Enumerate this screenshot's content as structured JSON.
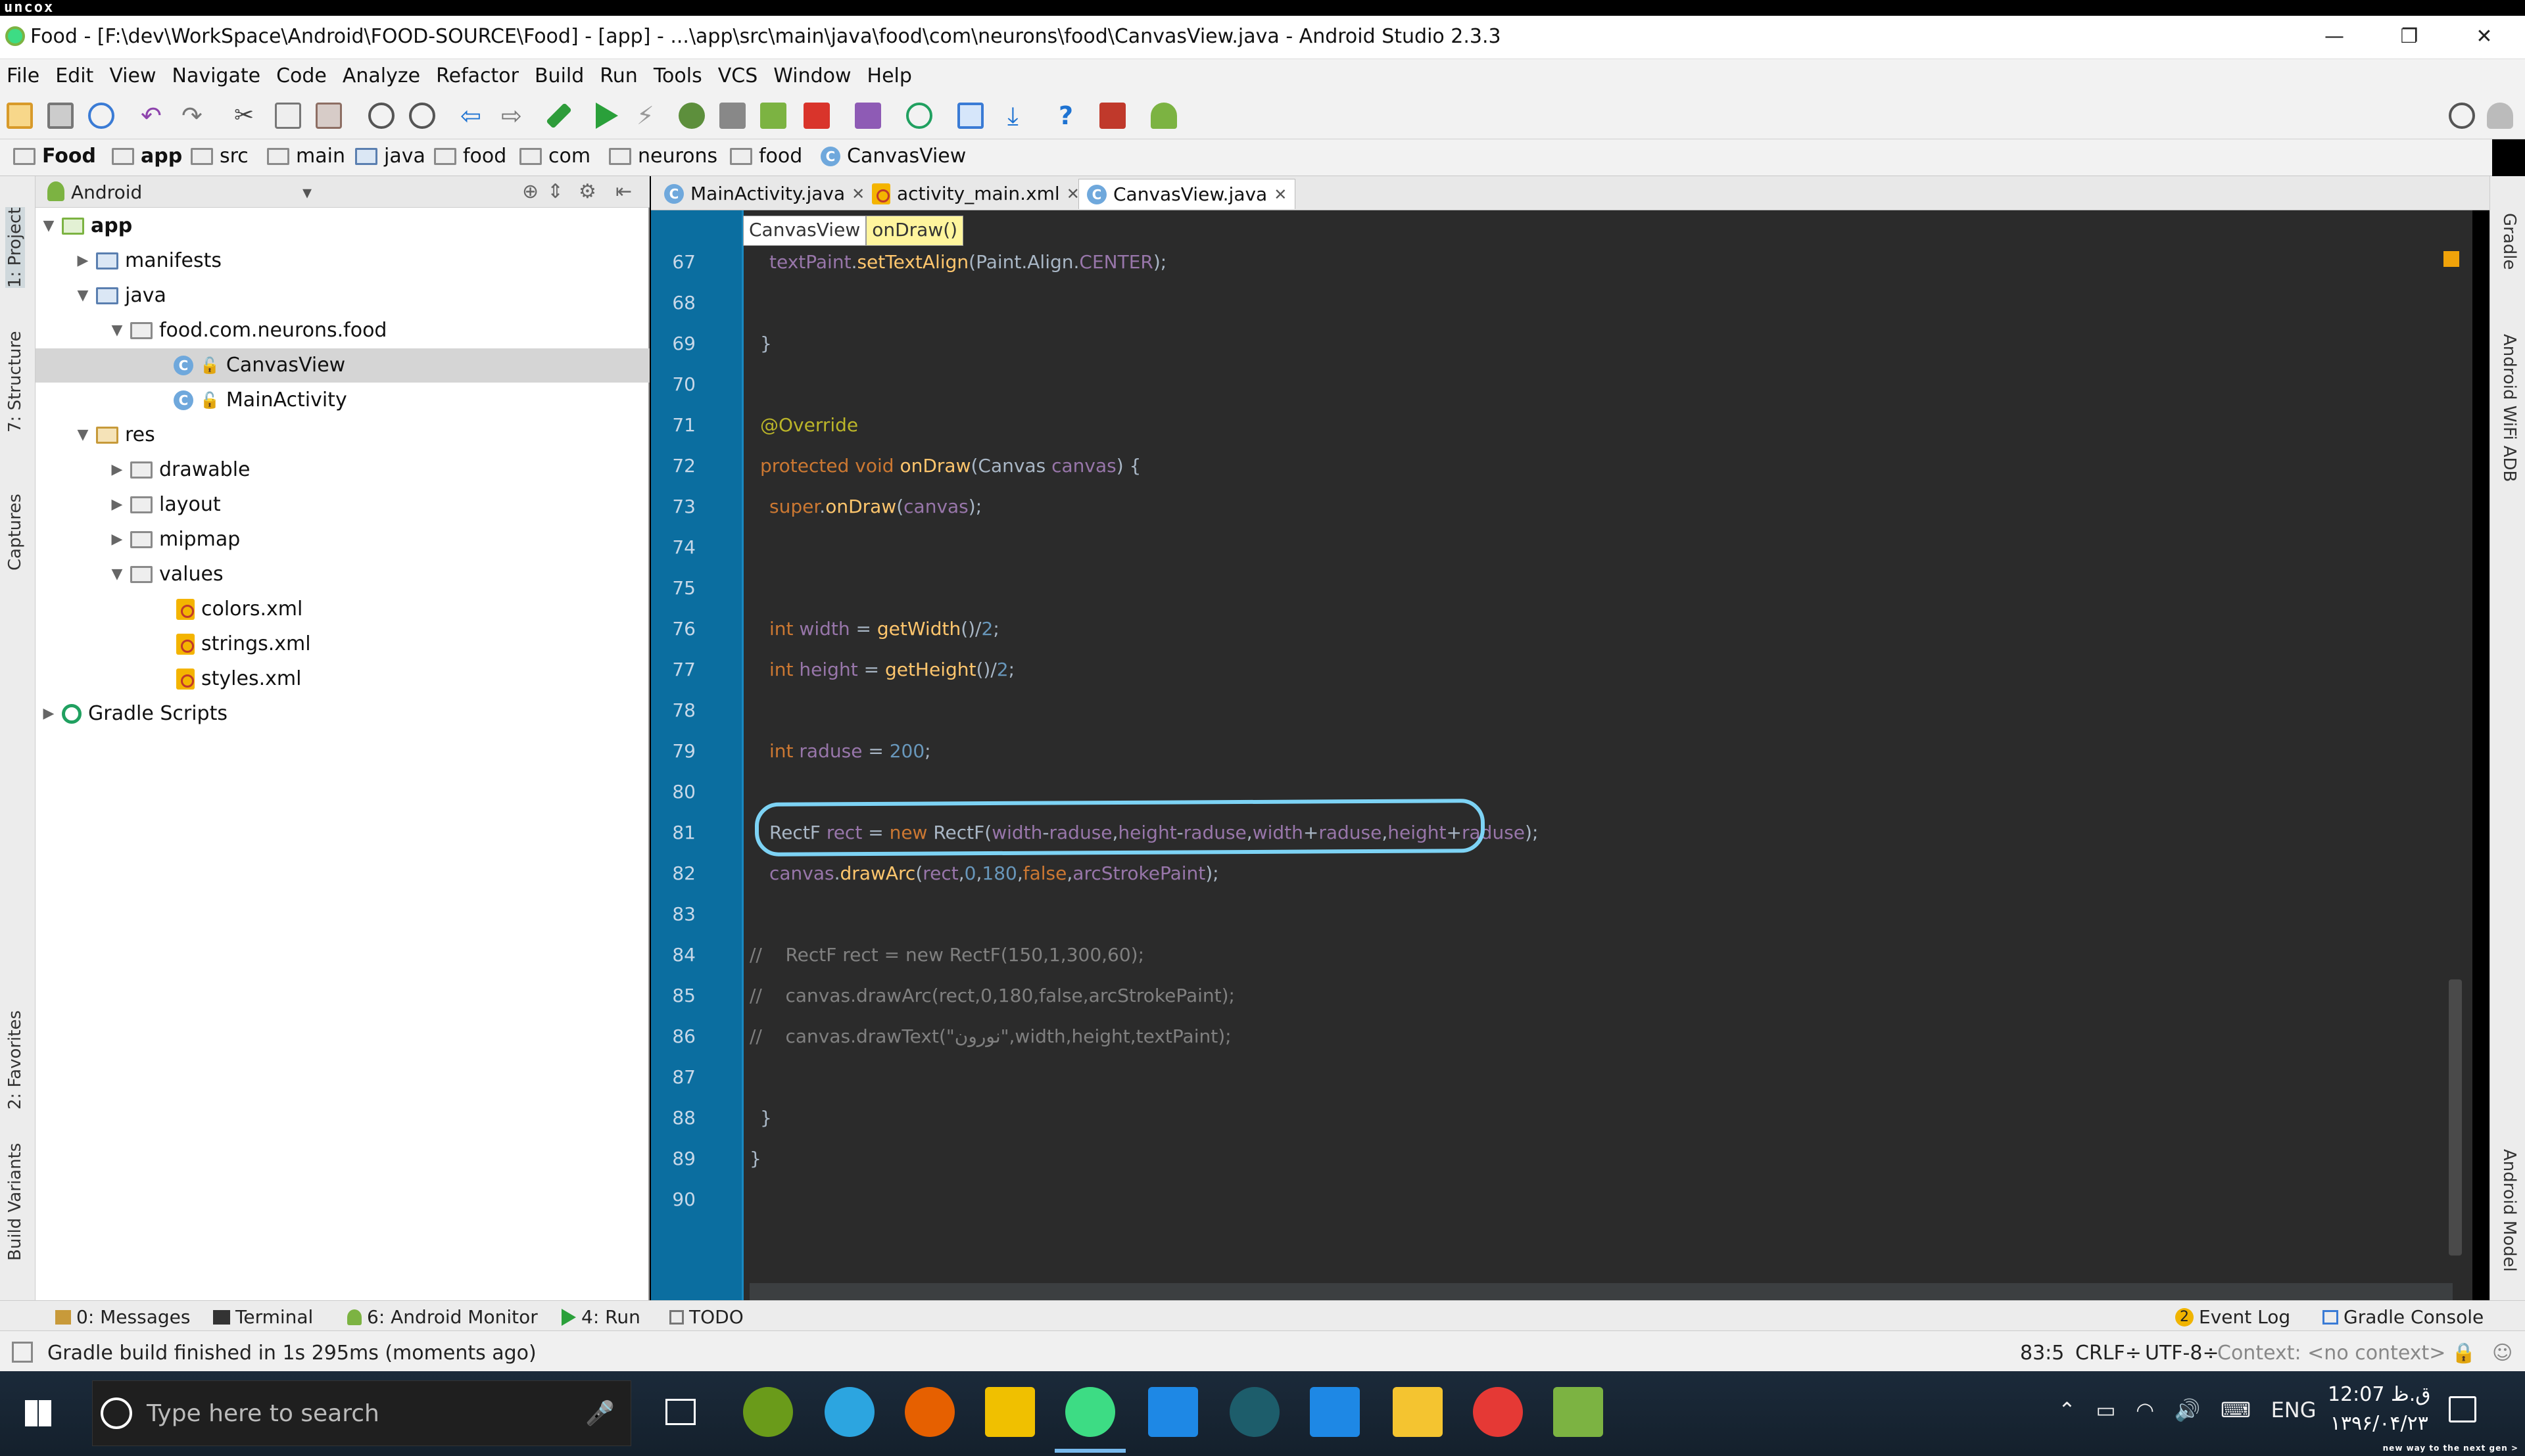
{
  "brand": "uncox",
  "window": {
    "title": "Food - [F:\\dev\\WorkSpace\\Android\\FOOD-SOURCE\\Food] - [app] - ...\\app\\src\\main\\java\\food\\com\\neurons\\food\\CanvasView.java - Android Studio 2.3.3",
    "minimize": "—",
    "restore": "❐",
    "close": "✕"
  },
  "menu": [
    "File",
    "Edit",
    "View",
    "Navigate",
    "Code",
    "Analyze",
    "Refactor",
    "Build",
    "Run",
    "Tools",
    "VCS",
    "Window",
    "Help"
  ],
  "breadcrumb": [
    "Food",
    "app",
    "src",
    "main",
    "java",
    "food",
    "com",
    "neurons",
    "food",
    "CanvasView"
  ],
  "left_tools": [
    "1: Project",
    "7: Structure",
    "Captures",
    "2: Favorites",
    "Build Variants"
  ],
  "right_tools": [
    "Gradle",
    "Android WiFi ADB",
    "Android Model"
  ],
  "project": {
    "view_mode": "Android",
    "tree": [
      {
        "label": "app",
        "depth": 0,
        "expanded": true,
        "kind": "module"
      },
      {
        "label": "manifests",
        "depth": 1,
        "expanded": false,
        "kind": "folder"
      },
      {
        "label": "java",
        "depth": 1,
        "expanded": true,
        "kind": "folder"
      },
      {
        "label": "food.com.neurons.food",
        "depth": 2,
        "expanded": true,
        "kind": "package"
      },
      {
        "label": "CanvasView",
        "depth": 3,
        "kind": "class",
        "selected": true
      },
      {
        "label": "MainActivity",
        "depth": 3,
        "kind": "class"
      },
      {
        "label": "res",
        "depth": 1,
        "expanded": true,
        "kind": "folder"
      },
      {
        "label": "drawable",
        "depth": 2,
        "expanded": false,
        "kind": "folder"
      },
      {
        "label": "layout",
        "depth": 2,
        "expanded": false,
        "kind": "folder"
      },
      {
        "label": "mipmap",
        "depth": 2,
        "expanded": false,
        "kind": "folder"
      },
      {
        "label": "values",
        "depth": 2,
        "expanded": true,
        "kind": "folder"
      },
      {
        "label": "colors.xml",
        "depth": 3,
        "kind": "xml"
      },
      {
        "label": "strings.xml",
        "depth": 3,
        "kind": "xml"
      },
      {
        "label": "styles.xml",
        "depth": 3,
        "kind": "xml"
      },
      {
        "label": "Gradle Scripts",
        "depth": 0,
        "expanded": false,
        "kind": "gradle"
      }
    ]
  },
  "editor": {
    "tabs": [
      {
        "label": "MainActivity.java",
        "active": false
      },
      {
        "label": "activity_main.xml",
        "active": false
      },
      {
        "label": "CanvasView.java",
        "active": true
      }
    ],
    "code_breadcrumb": [
      "CanvasView",
      "onDraw()"
    ],
    "lines": [
      {
        "n": "67",
        "text": "textPaint.setTextAlign(Paint.Align.CENTER);"
      },
      {
        "n": "68",
        "text": ""
      },
      {
        "n": "69",
        "text": "}"
      },
      {
        "n": "70",
        "text": ""
      },
      {
        "n": "71",
        "text": "@Override"
      },
      {
        "n": "72",
        "text": "protected void onDraw(Canvas canvas) {"
      },
      {
        "n": "73",
        "text": "super.onDraw(canvas);"
      },
      {
        "n": "74",
        "text": ""
      },
      {
        "n": "75",
        "text": ""
      },
      {
        "n": "76",
        "text": "int width = getWidth()/2;"
      },
      {
        "n": "77",
        "text": "int height = getHeight()/2;"
      },
      {
        "n": "78",
        "text": ""
      },
      {
        "n": "79",
        "text": "int raduse = 200;"
      },
      {
        "n": "80",
        "text": ""
      },
      {
        "n": "81",
        "text": "RectF rect = new RectF(width-raduse,height-raduse,width+raduse,height+raduse);"
      },
      {
        "n": "82",
        "text": "canvas.drawArc(rect,0,180,false,arcStrokePaint);"
      },
      {
        "n": "83",
        "text": ""
      },
      {
        "n": "84",
        "text": "//    RectF rect = new RectF(150,1,300,60);"
      },
      {
        "n": "85",
        "text": "//    canvas.drawArc(rect,0,180,false,arcStrokePaint);"
      },
      {
        "n": "86",
        "text": "//    canvas.drawText(\"نورون\",width,height,textPaint);"
      },
      {
        "n": "87",
        "text": ""
      },
      {
        "n": "88",
        "text": "}"
      },
      {
        "n": "89",
        "text": "}"
      },
      {
        "n": "90",
        "text": ""
      }
    ]
  },
  "bottom_tabs": [
    {
      "label": "0: Messages"
    },
    {
      "label": "Terminal"
    },
    {
      "label": "6: Android Monitor"
    },
    {
      "label": "4: Run"
    },
    {
      "label": "TODO"
    }
  ],
  "bottom_right_tabs": [
    {
      "label": "Event Log",
      "badge": "2"
    },
    {
      "label": "Gradle Console"
    }
  ],
  "status": {
    "message": "Gradle build finished in 1s 295ms (moments ago)",
    "position": "83:5",
    "line_sep": "CRLF÷",
    "encoding": "UTF-8÷",
    "context": "Context: <no context>"
  },
  "taskbar": {
    "search_placeholder": "Type here to search",
    "lang": "ENG",
    "time": "12:07 ق.ظ",
    "date": "۱۳۹۶/۰۴/۲۳",
    "tagline": "new way to the next gen >"
  }
}
